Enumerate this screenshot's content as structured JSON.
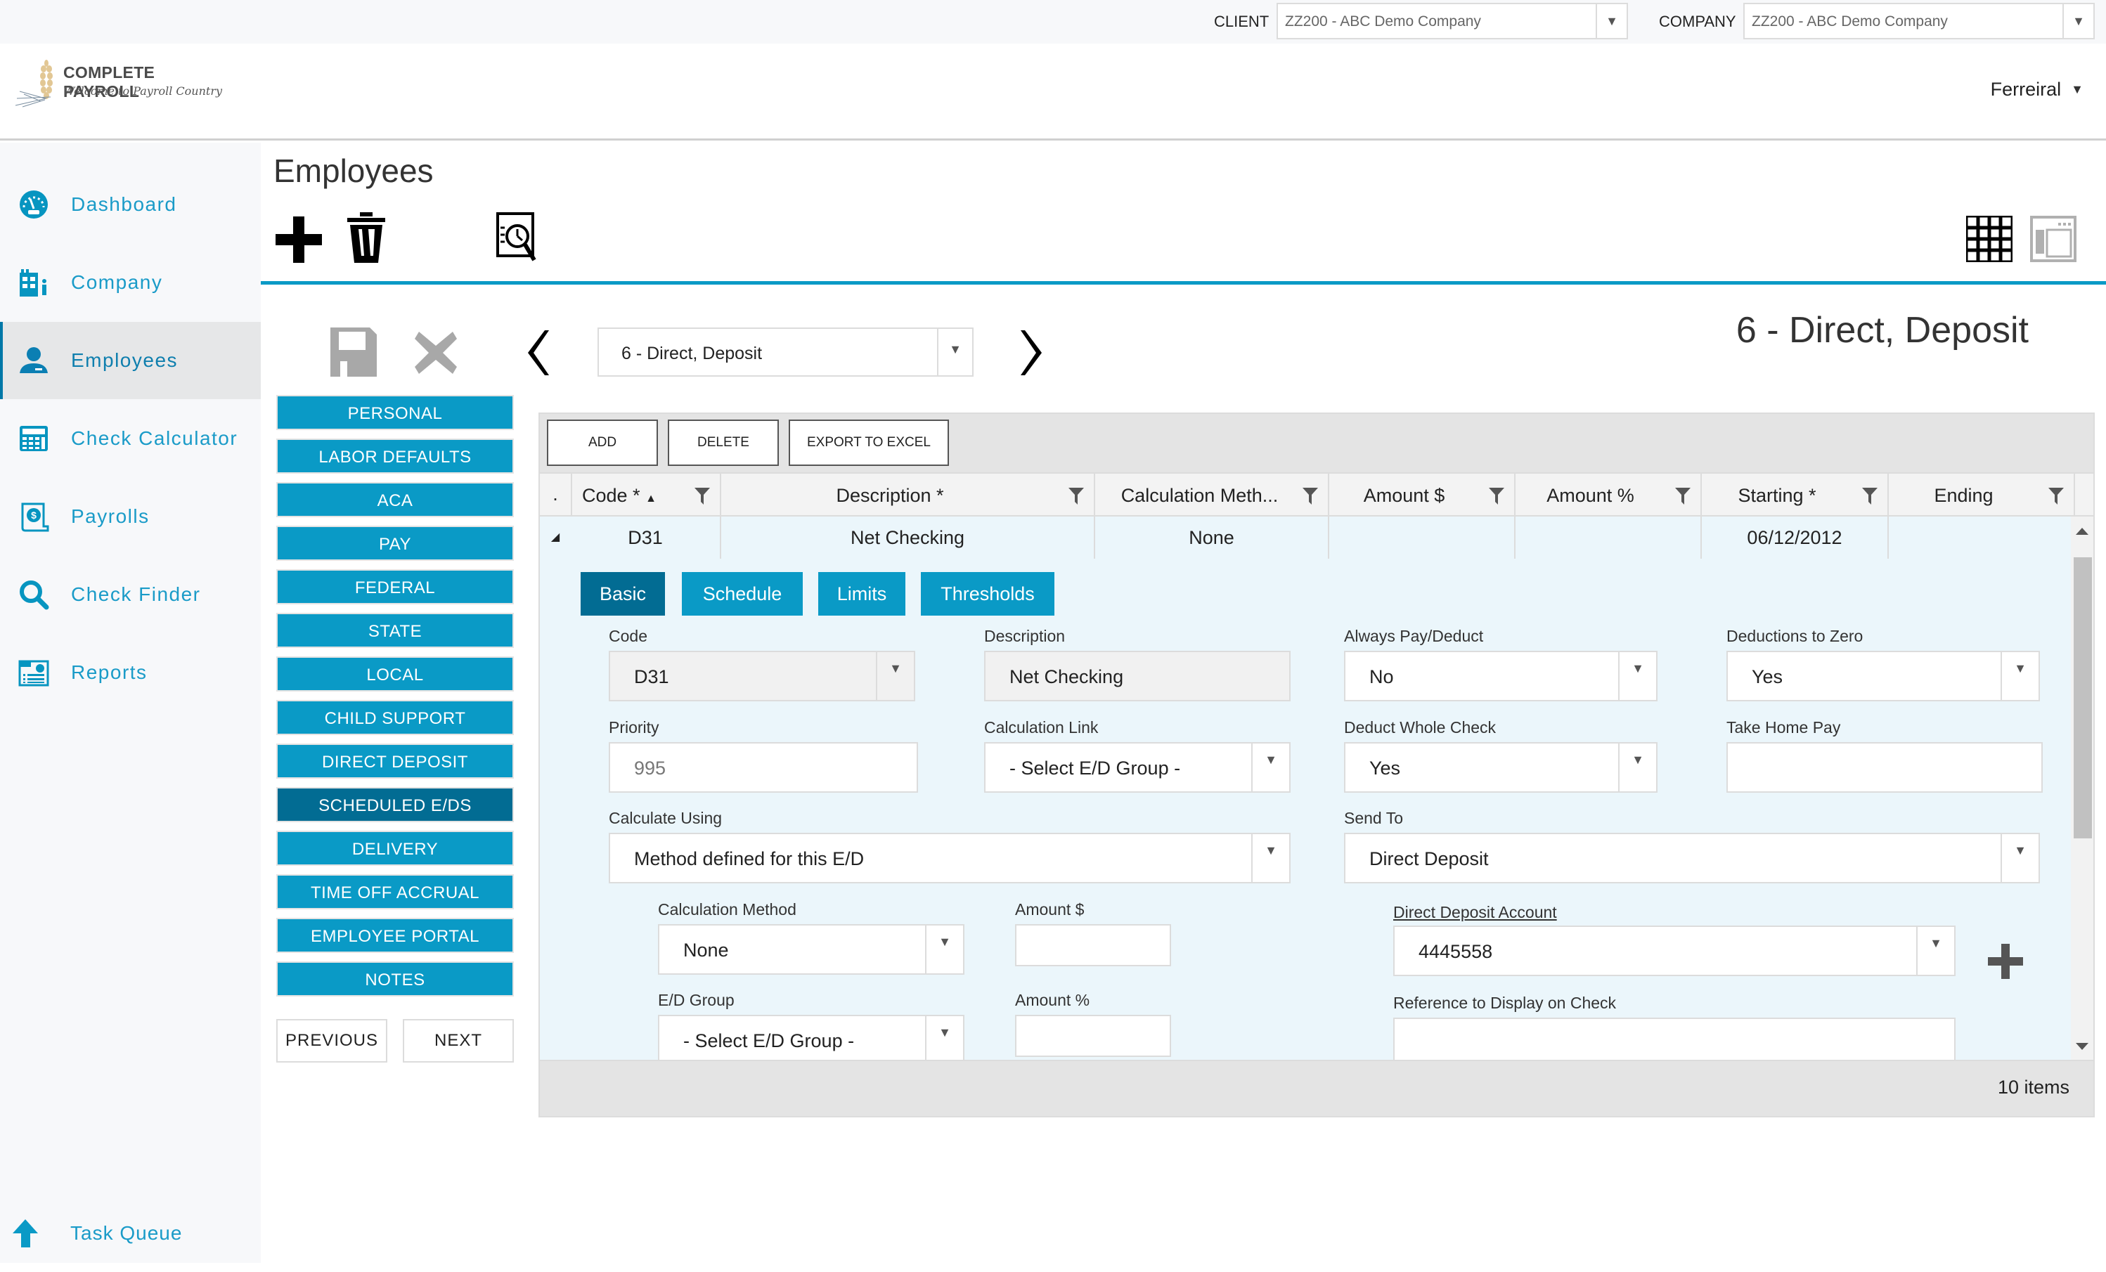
{
  "topbar": {
    "client_label": "CLIENT",
    "client_value": "ZZ200 - ABC Demo Company",
    "company_label": "COMPANY",
    "company_value": "ZZ200 - ABC Demo Company"
  },
  "header": {
    "brand": "COMPLETE PAYROLL",
    "tagline": "Welcome to Payroll Country",
    "user": "Ferreiral"
  },
  "sidebar": {
    "items": [
      {
        "label": "Dashboard",
        "icon": "dashboard-icon"
      },
      {
        "label": "Company",
        "icon": "company-icon"
      },
      {
        "label": "Employees",
        "icon": "employee-icon",
        "active": true
      },
      {
        "label": "Check Calculator",
        "icon": "calculator-icon"
      },
      {
        "label": "Payrolls",
        "icon": "payroll-icon"
      },
      {
        "label": "Check Finder",
        "icon": "search-icon"
      },
      {
        "label": "Reports",
        "icon": "reports-icon"
      }
    ],
    "task_queue": {
      "label": "Task Queue",
      "icon": "arrow-up-icon"
    }
  },
  "page": {
    "title": "Employees",
    "record_select_value": "6 - Direct, Deposit",
    "record_title": "6 - Direct, Deposit"
  },
  "sections": {
    "items": [
      "PERSONAL",
      "LABOR DEFAULTS",
      "ACA",
      "PAY",
      "FEDERAL",
      "STATE",
      "LOCAL",
      "CHILD SUPPORT",
      "DIRECT DEPOSIT",
      "SCHEDULED E/DS",
      "DELIVERY",
      "TIME OFF ACCRUAL",
      "EMPLOYEE PORTAL",
      "NOTES"
    ],
    "active": "SCHEDULED E/DS",
    "previous_label": "PREVIOUS",
    "next_label": "NEXT"
  },
  "grid": {
    "toolbar": {
      "add": "ADD",
      "delete": "DELETE",
      "export": "EXPORT TO EXCEL"
    },
    "columns": [
      "Code *",
      "Description *",
      "Calculation Meth...",
      "Amount $",
      "Amount %",
      "Starting *",
      "Ending"
    ],
    "rows": [
      {
        "code": "D31",
        "description": "Net Checking",
        "calc_method": "None",
        "amount_dollar": "",
        "amount_pct": "",
        "starting": "06/12/2012",
        "ending": ""
      }
    ],
    "item_count": "10 items"
  },
  "detail": {
    "tabs": [
      "Basic",
      "Schedule",
      "Limits",
      "Thresholds"
    ],
    "active_tab": "Basic",
    "fields": {
      "code": {
        "label": "Code",
        "value": "D31"
      },
      "description": {
        "label": "Description",
        "value": "Net Checking"
      },
      "always_pay": {
        "label": "Always Pay/Deduct",
        "value": "No"
      },
      "deductions_zero": {
        "label": "Deductions to Zero",
        "value": "Yes"
      },
      "priority": {
        "label": "Priority",
        "value": "995"
      },
      "calc_link": {
        "label": "Calculation Link",
        "value": "- Select E/D Group -"
      },
      "deduct_whole": {
        "label": "Deduct Whole Check",
        "value": "Yes"
      },
      "take_home": {
        "label": "Take Home Pay",
        "value": ""
      },
      "calculate_using": {
        "label": "Calculate Using",
        "value": "Method defined for this E/D"
      },
      "send_to": {
        "label": "Send To",
        "value": "Direct Deposit"
      },
      "calc_method": {
        "label": "Calculation Method",
        "value": "None"
      },
      "amount_dollar": {
        "label": "Amount $",
        "value": ""
      },
      "ed_group": {
        "label": "E/D Group",
        "value": "- Select E/D Group -"
      },
      "amount_pct": {
        "label": "Amount %",
        "value": ""
      },
      "dd_account": {
        "label": "Direct Deposit Account",
        "value": "4445558"
      },
      "reference": {
        "label": "Reference to Display on Check",
        "value": ""
      }
    }
  },
  "colors": {
    "accent": "#0a9ac6",
    "accent_dark": "#026c93",
    "sidebar_text": "#1a9bc8"
  }
}
